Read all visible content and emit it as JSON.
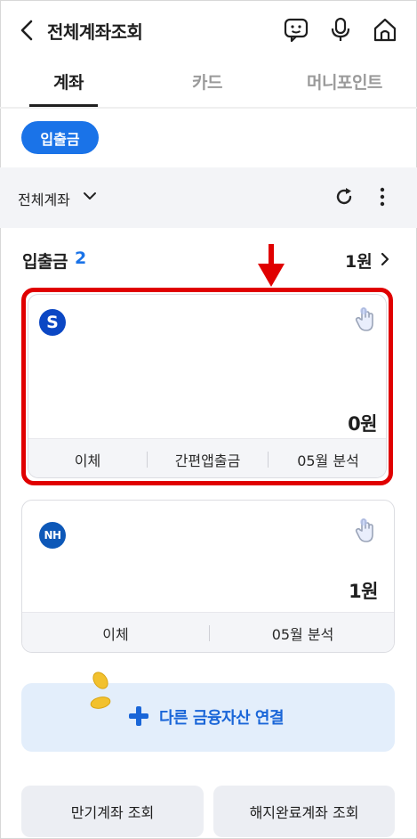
{
  "header": {
    "title": "전체계좌조회",
    "icons": [
      "back-icon",
      "chatbot-icon",
      "microphone-icon",
      "home-icon"
    ]
  },
  "tabs": [
    {
      "label": "계좌",
      "active": true
    },
    {
      "label": "카드",
      "active": false
    },
    {
      "label": "머니포인트",
      "active": false
    }
  ],
  "chip": {
    "label": "입출금",
    "color": "#1a73e8"
  },
  "filter": {
    "label": "전체계좌",
    "icons": [
      "chevron-down-icon",
      "refresh-icon",
      "more-vertical-icon"
    ]
  },
  "section": {
    "title": "입출금",
    "count": "2",
    "total": "1원"
  },
  "accounts": [
    {
      "bank_logo": "S",
      "balance": "0원",
      "actions": [
        "이체",
        "간편앱출금",
        "05월 분석"
      ],
      "highlighted": true
    },
    {
      "bank_logo": "NH",
      "balance": "1원",
      "actions": [
        "이체",
        "05월 분석"
      ],
      "highlighted": false
    }
  ],
  "connect": {
    "label": "다른 금융자산 연결"
  },
  "bottom_buttons": [
    "만기계좌 조회",
    "해지완료계좌 조회"
  ],
  "colors": {
    "accent": "#1a73e8",
    "highlight": "#e00000"
  }
}
